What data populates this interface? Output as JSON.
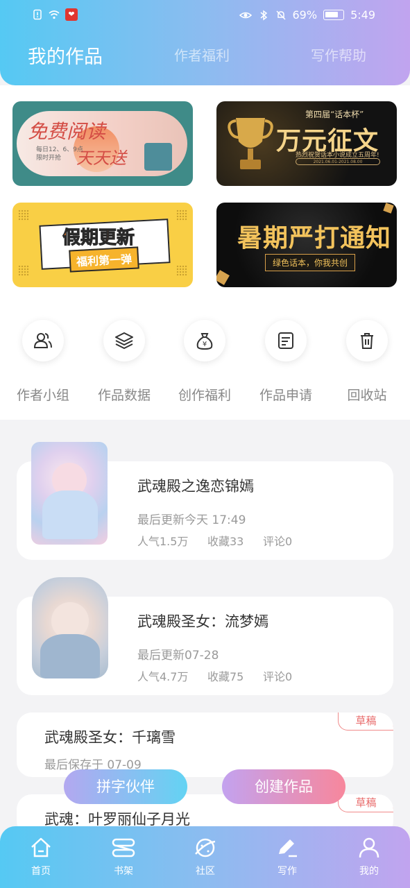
{
  "status_bar": {
    "battery": "69%",
    "time": "5:49",
    "badge": "❤"
  },
  "header": {
    "tabs": [
      {
        "label": "我的作品",
        "active": true
      },
      {
        "label": "作者福利",
        "active": false
      },
      {
        "label": "写作帮助",
        "active": false
      }
    ]
  },
  "banners": [
    {
      "title": "免费阅读",
      "title2": "天天送",
      "note": "每日12、6、9点\n限时开抢"
    },
    {
      "title_small": "第四届“话本杯”",
      "title": "万元征文",
      "note": "热烈祝贺话本小说成立五周年!",
      "date": "2021.06.01-2021.08.00"
    },
    {
      "title": "假期更新",
      "subtitle": "福利第一弹"
    },
    {
      "title": "暑期严打通知",
      "subtitle": "绿色话本，你我共创"
    }
  ],
  "actions": [
    {
      "label": "作者小组",
      "icon": "users-icon"
    },
    {
      "label": "作品数据",
      "icon": "layers-icon"
    },
    {
      "label": "创作福利",
      "icon": "money-bag-icon"
    },
    {
      "label": "作品申请",
      "icon": "document-icon"
    },
    {
      "label": "回收站",
      "icon": "trash-icon"
    }
  ],
  "works": [
    {
      "title": "武魂殿之逸恋锦嫣",
      "updated": "最后更新今天 17:49",
      "popularity": "人气1.5万",
      "favorites": "收藏33",
      "comments": "评论0"
    },
    {
      "title": "武魂殿圣女：流梦嫣",
      "updated": "最后更新07-28",
      "popularity": "人气4.7万",
      "favorites": "收藏75",
      "comments": "评论0"
    }
  ],
  "drafts": [
    {
      "title": "武魂殿圣女：千璃雪",
      "saved": "最后保存于 07-09",
      "tag": "草稿"
    },
    {
      "title": "武魂：叶罗丽仙子月光",
      "tag": "草稿"
    }
  ],
  "floating": {
    "partner": "拼字伙伴",
    "create": "创建作品"
  },
  "bottom_nav": [
    {
      "label": "首页",
      "icon": "home-icon"
    },
    {
      "label": "书架",
      "icon": "bookshelf-icon"
    },
    {
      "label": "社区",
      "icon": "planet-icon"
    },
    {
      "label": "写作",
      "icon": "pen-icon",
      "active": true
    },
    {
      "label": "我的",
      "icon": "user-icon"
    }
  ]
}
